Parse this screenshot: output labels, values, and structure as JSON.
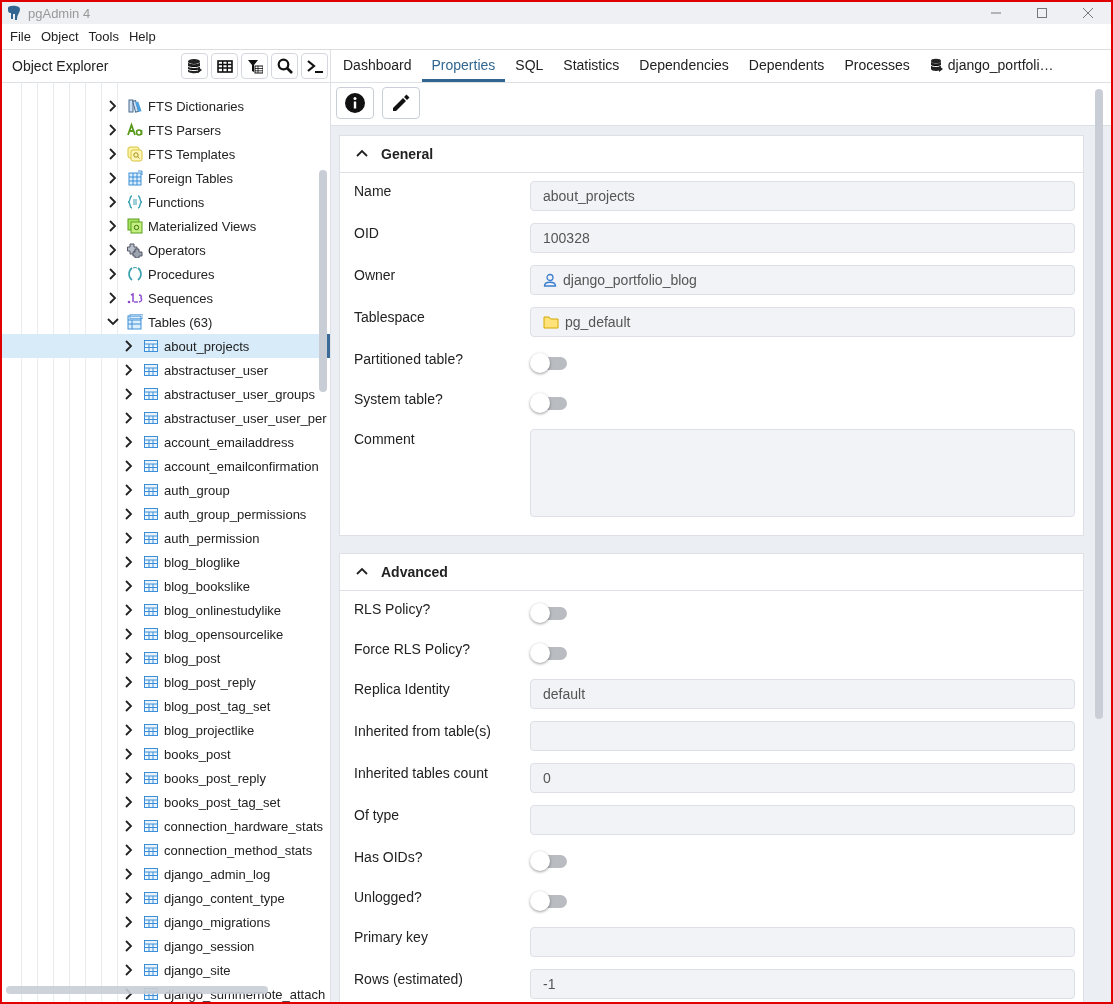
{
  "window": {
    "title": "pgAdmin 4"
  },
  "menu": [
    "File",
    "Object",
    "Tools",
    "Help"
  ],
  "object_explorer": {
    "title": "Object Explorer",
    "tree": [
      {
        "label": "FTS Dictionaries",
        "kind": "dictionaries",
        "expanded": false
      },
      {
        "label": "FTS Parsers",
        "kind": "parsers",
        "expanded": false
      },
      {
        "label": "FTS Templates",
        "kind": "templates",
        "expanded": false
      },
      {
        "label": "Foreign Tables",
        "kind": "foreign",
        "expanded": false
      },
      {
        "label": "Functions",
        "kind": "functions",
        "expanded": false
      },
      {
        "label": "Materialized Views",
        "kind": "matviews",
        "expanded": false
      },
      {
        "label": "Operators",
        "kind": "operators",
        "expanded": false
      },
      {
        "label": "Procedures",
        "kind": "procedures",
        "expanded": false
      },
      {
        "label": "Sequences",
        "kind": "sequences",
        "expanded": false
      },
      {
        "label": "Tables (63)",
        "kind": "tables",
        "expanded": true,
        "children": [
          {
            "label": "about_projects",
            "kind": "table",
            "expanded": false,
            "selected": true
          },
          {
            "label": "abstractuser_user",
            "kind": "table",
            "expanded": false,
            "selected": false
          },
          {
            "label": "abstractuser_user_groups",
            "kind": "table",
            "expanded": false,
            "selected": false
          },
          {
            "label": "abstractuser_user_user_per",
            "kind": "table",
            "expanded": false,
            "selected": false
          },
          {
            "label": "account_emailaddress",
            "kind": "table",
            "expanded": false,
            "selected": false
          },
          {
            "label": "account_emailconfirmation",
            "kind": "table",
            "expanded": false,
            "selected": false
          },
          {
            "label": "auth_group",
            "kind": "table",
            "expanded": false,
            "selected": false
          },
          {
            "label": "auth_group_permissions",
            "kind": "table",
            "expanded": false,
            "selected": false
          },
          {
            "label": "auth_permission",
            "kind": "table",
            "expanded": false,
            "selected": false
          },
          {
            "label": "blog_bloglike",
            "kind": "table",
            "expanded": false,
            "selected": false
          },
          {
            "label": "blog_bookslike",
            "kind": "table",
            "expanded": false,
            "selected": false
          },
          {
            "label": "blog_onlinestudylike",
            "kind": "table",
            "expanded": false,
            "selected": false
          },
          {
            "label": "blog_opensourcelike",
            "kind": "table",
            "expanded": false,
            "selected": false
          },
          {
            "label": "blog_post",
            "kind": "table",
            "expanded": false,
            "selected": false
          },
          {
            "label": "blog_post_reply",
            "kind": "table",
            "expanded": false,
            "selected": false
          },
          {
            "label": "blog_post_tag_set",
            "kind": "table",
            "expanded": false,
            "selected": false
          },
          {
            "label": "blog_projectlike",
            "kind": "table",
            "expanded": false,
            "selected": false
          },
          {
            "label": "books_post",
            "kind": "table",
            "expanded": false,
            "selected": false
          },
          {
            "label": "books_post_reply",
            "kind": "table",
            "expanded": false,
            "selected": false
          },
          {
            "label": "books_post_tag_set",
            "kind": "table",
            "expanded": false,
            "selected": false
          },
          {
            "label": "connection_hardware_stats",
            "kind": "table",
            "expanded": false,
            "selected": false
          },
          {
            "label": "connection_method_stats",
            "kind": "table",
            "expanded": false,
            "selected": false
          },
          {
            "label": "django_admin_log",
            "kind": "table",
            "expanded": false,
            "selected": false
          },
          {
            "label": "django_content_type",
            "kind": "table",
            "expanded": false,
            "selected": false
          },
          {
            "label": "django_migrations",
            "kind": "table",
            "expanded": false,
            "selected": false
          },
          {
            "label": "django_session",
            "kind": "table",
            "expanded": false,
            "selected": false
          },
          {
            "label": "django_site",
            "kind": "table",
            "expanded": false,
            "selected": false
          },
          {
            "label": "django_summernote_attach",
            "kind": "table",
            "expanded": false,
            "selected": false
          }
        ]
      }
    ]
  },
  "tabs": [
    {
      "label": "Dashboard",
      "selected": false
    },
    {
      "label": "Properties",
      "selected": true
    },
    {
      "label": "SQL",
      "selected": false
    },
    {
      "label": "Statistics",
      "selected": false
    },
    {
      "label": "Dependencies",
      "selected": false
    },
    {
      "label": "Dependents",
      "selected": false
    },
    {
      "label": "Processes",
      "selected": false
    },
    {
      "label": "django_portfoli…",
      "selected": false,
      "kind": "query"
    }
  ],
  "sections": [
    {
      "title": "General",
      "expanded": true,
      "fields": [
        {
          "label": "Name",
          "kind": "text",
          "value": "about_projects"
        },
        {
          "label": "OID",
          "kind": "text",
          "value": "100328"
        },
        {
          "label": "Owner",
          "kind": "user",
          "value": "django_portfolio_blog"
        },
        {
          "label": "Tablespace",
          "kind": "folder",
          "value": "pg_default"
        },
        {
          "label": "Partitioned table?",
          "kind": "switch",
          "on": false
        },
        {
          "label": "System table?",
          "kind": "switch",
          "on": false
        },
        {
          "label": "Comment",
          "kind": "textarea"
        }
      ]
    },
    {
      "title": "Advanced",
      "expanded": true,
      "fields": [
        {
          "label": "RLS Policy?",
          "kind": "switch",
          "on": false
        },
        {
          "label": "Force RLS Policy?",
          "kind": "switch",
          "on": false
        },
        {
          "label": "Replica Identity",
          "kind": "text",
          "value": "default"
        },
        {
          "label": "Inherited from table(s)",
          "kind": "text"
        },
        {
          "label": "Inherited tables count",
          "kind": "text",
          "value": "0"
        },
        {
          "label": "Of type",
          "kind": "text"
        },
        {
          "label": "Has OIDs?",
          "kind": "switch",
          "on": false
        },
        {
          "label": "Unlogged?",
          "kind": "switch",
          "on": false
        },
        {
          "label": "Primary key",
          "kind": "text"
        },
        {
          "label": "Rows (estimated)",
          "kind": "text",
          "value": "-1"
        }
      ]
    }
  ]
}
